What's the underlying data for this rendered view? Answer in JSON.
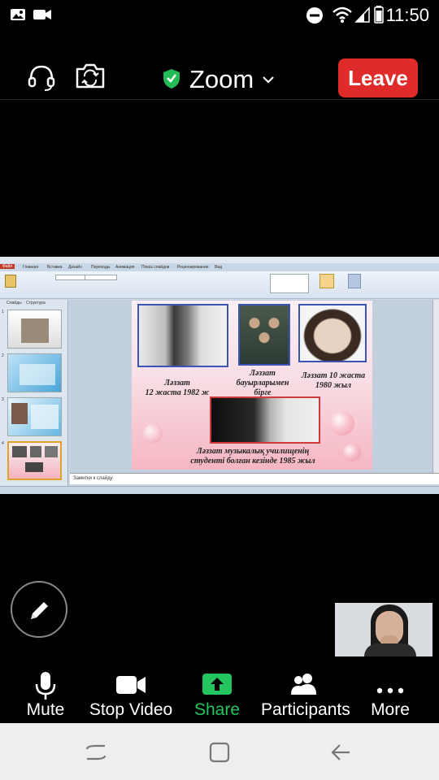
{
  "status_bar": {
    "time": "11:50",
    "icons": [
      "image-icon",
      "video-camera-icon",
      "do-not-disturb-icon",
      "wifi-icon",
      "signal-icon",
      "battery-icon"
    ]
  },
  "header": {
    "title": "Zoom",
    "leave_label": "Leave",
    "shield_color": "#22bb55",
    "leave_color": "#e02b2b",
    "icons": [
      "headset-icon",
      "switch-camera-icon",
      "shield-check-icon",
      "chevron-down-icon"
    ]
  },
  "shared_screen": {
    "ribbon_tabs": [
      "Файл",
      "Главная",
      "Вставка",
      "Дизайн",
      "Переходы",
      "Анимация",
      "Показ слайдов",
      "Рецензирование",
      "Вид"
    ],
    "panel_tabs": [
      "Слайды",
      "Структура"
    ],
    "thumb_numbers": [
      "1",
      "2",
      "3",
      "4"
    ],
    "slide": {
      "cap1": [
        "Ләззат",
        "12 жаста 1982 ж"
      ],
      "cap2": [
        "Ләззат",
        "бауырларымен",
        "бірге"
      ],
      "cap3": [
        "Ләззат 10 жаста",
        "1980 жыл"
      ],
      "cap4": [
        "Ләззат музыкалық училищенің",
        "студенті болған кезінде 1985 жыл"
      ]
    },
    "notes_placeholder": "Заметки к слайду"
  },
  "toolbar": {
    "mute": "Mute",
    "stop_video": "Stop Video",
    "share": "Share",
    "participants": "Participants",
    "more": "More",
    "share_color": "#22c55e"
  },
  "nav": {
    "icons": [
      "recent-apps-icon",
      "home-icon",
      "back-icon"
    ]
  }
}
